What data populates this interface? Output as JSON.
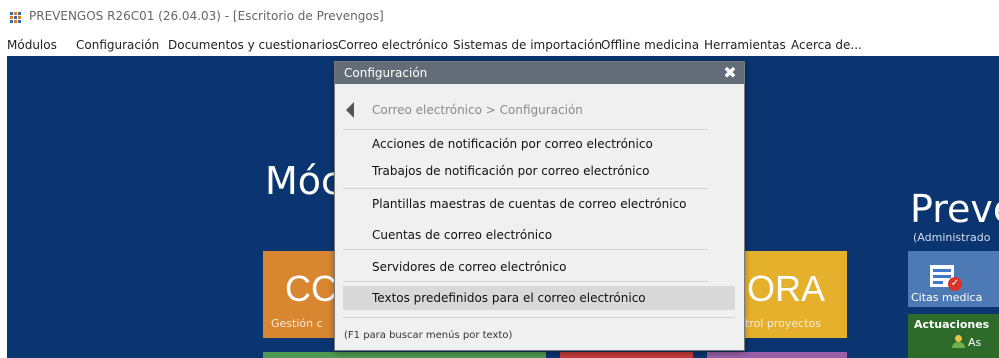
{
  "window": {
    "title": "PREVENGOS R26C01 (26.04.03) - [Escritorio de Prevengos]",
    "icon": "app-logo-icon"
  },
  "menubar": {
    "items": [
      "Módulos",
      "Configuración",
      "Documentos y cuestionarios",
      "Correo electrónico",
      "Sistemas de importación",
      "Offline medicina",
      "Herramientas",
      "Acerca de..."
    ]
  },
  "desktop": {
    "background": "#0a3570",
    "modulos_heading": "Móc",
    "prevengos_heading": "Preve",
    "prevengos_sub": "(Administrado",
    "tile_left_big": "CC",
    "tile_left_small": "Gestión c",
    "tile_right_big": "IORA",
    "tile_right_small": "trol proyectos",
    "citas_label": "Citas medica",
    "actuaciones_title": "Actuaciones",
    "actuaciones_sub": "As",
    "colors": {
      "orange_tile": "#d98631",
      "yellow_tile": "#e5b12c",
      "green_tile": "#4f9a52",
      "red_tile": "#c63a3a",
      "purple_tile": "#9b5fa8"
    }
  },
  "dialog": {
    "title": "Configuración",
    "close_label": "✖",
    "breadcrumb": "Correo electrónico > Configuración",
    "items": [
      {
        "label": "Acciones de notificación por correo electrónico"
      },
      {
        "label": "Trabajos de notificación por correo electrónico"
      },
      {
        "label": "Plantillas maestras de cuentas de correo electrónico"
      },
      {
        "label": "Cuentas de correo electrónico"
      },
      {
        "label": "Servidores de correo electrónico"
      },
      {
        "label": "Textos predefinidos para el correo electrónico",
        "selected": true
      }
    ],
    "hint": "(F1 para buscar menús por texto)",
    "header_color": "#636c77"
  }
}
